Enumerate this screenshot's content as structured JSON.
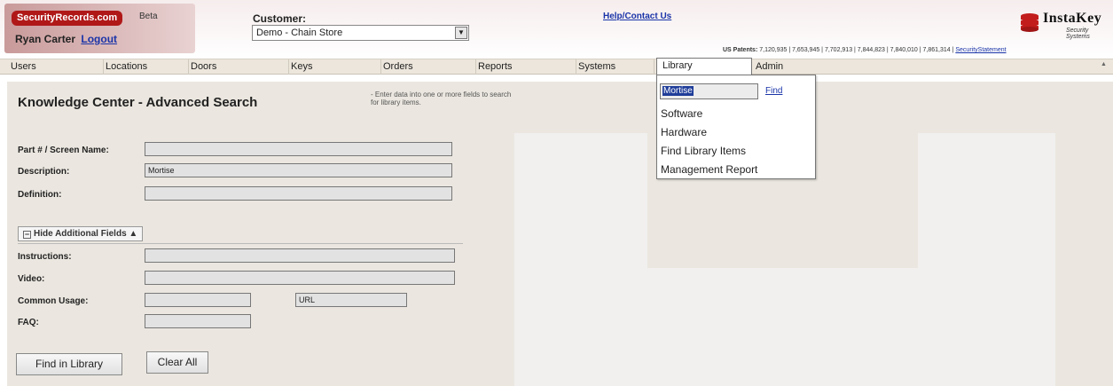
{
  "header": {
    "logo_text": "SecurityRecords.com",
    "beta": "Beta",
    "user_name": "Ryan Carter",
    "logout": "Logout",
    "customer_label": "Customer:",
    "customer_value": "Demo - Chain Store",
    "help_link": "Help/Contact Us",
    "brand_name": "InstaKey",
    "brand_sub": "Security Systems",
    "patents_label": "US Patents:",
    "patents_list": "7,120,935 | 7,653,945 | 7,702,913 | 7,844,823 | 7,840,010 | 7,861,314",
    "security_statement": "SecurityStatement"
  },
  "nav": {
    "items": [
      "Users",
      "Locations",
      "Doors",
      "Keys",
      "Orders",
      "Reports",
      "Systems",
      "Library",
      "Admin"
    ]
  },
  "page": {
    "title": "Knowledge Center - Advanced Search",
    "hint": "- Enter data into one or more fields to search for library items.",
    "fields": {
      "part_label": "Part # / Screen Name:",
      "part_value": "",
      "description_label": "Description:",
      "description_value": "Mortise",
      "definition_label": "Definition:",
      "definition_value": "",
      "instructions_label": "Instructions:",
      "instructions_value": "",
      "video_label": "Video:",
      "video_value": "",
      "common_usage_label": "Common Usage:",
      "common_usage_value": "",
      "url_value": "URL",
      "faq_label": "FAQ:",
      "faq_value": ""
    },
    "toggle_label": "Hide Additional Fields",
    "find_button": "Find in Library",
    "clear_button": "Clear All"
  },
  "library_menu": {
    "search_value": "Mortise",
    "find_link": "Find",
    "items": [
      "Software",
      "Hardware",
      "Find Library Items",
      "Management Report"
    ]
  },
  "colors": {
    "brand_red": "#b01818",
    "link_blue": "#1a34a8",
    "panel_bg": "#ebe7e0"
  }
}
